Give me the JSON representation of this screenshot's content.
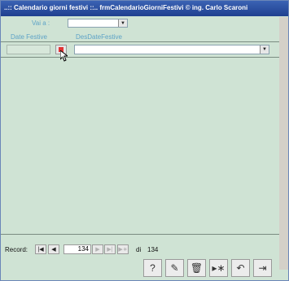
{
  "window": {
    "title": "..:: Calendario giorni festivi ::..   frmCalendarioGiorniFestivi © ing. Carlo Scaroni"
  },
  "filter": {
    "vai_label": "Vai a :",
    "vai_value": ""
  },
  "columns": {
    "date_header": "Date Festive",
    "desc_header": "DesDateFestive"
  },
  "record_row": {
    "date_value": "",
    "desc_value": ""
  },
  "navigation": {
    "record_label": "Record:",
    "current": "134",
    "of_label": "di",
    "total": "134"
  },
  "toolbar": {
    "buttons": [
      {
        "icon": "help-icon",
        "glyph": "?"
      },
      {
        "icon": "new-record-icon",
        "glyph": "✎"
      },
      {
        "icon": "delete-icon",
        "glyph": "🗑"
      },
      {
        "icon": "find-icon",
        "glyph": "▸∗"
      },
      {
        "icon": "undo-icon",
        "glyph": "↶"
      },
      {
        "icon": "exit-icon",
        "glyph": "⇥"
      }
    ]
  }
}
